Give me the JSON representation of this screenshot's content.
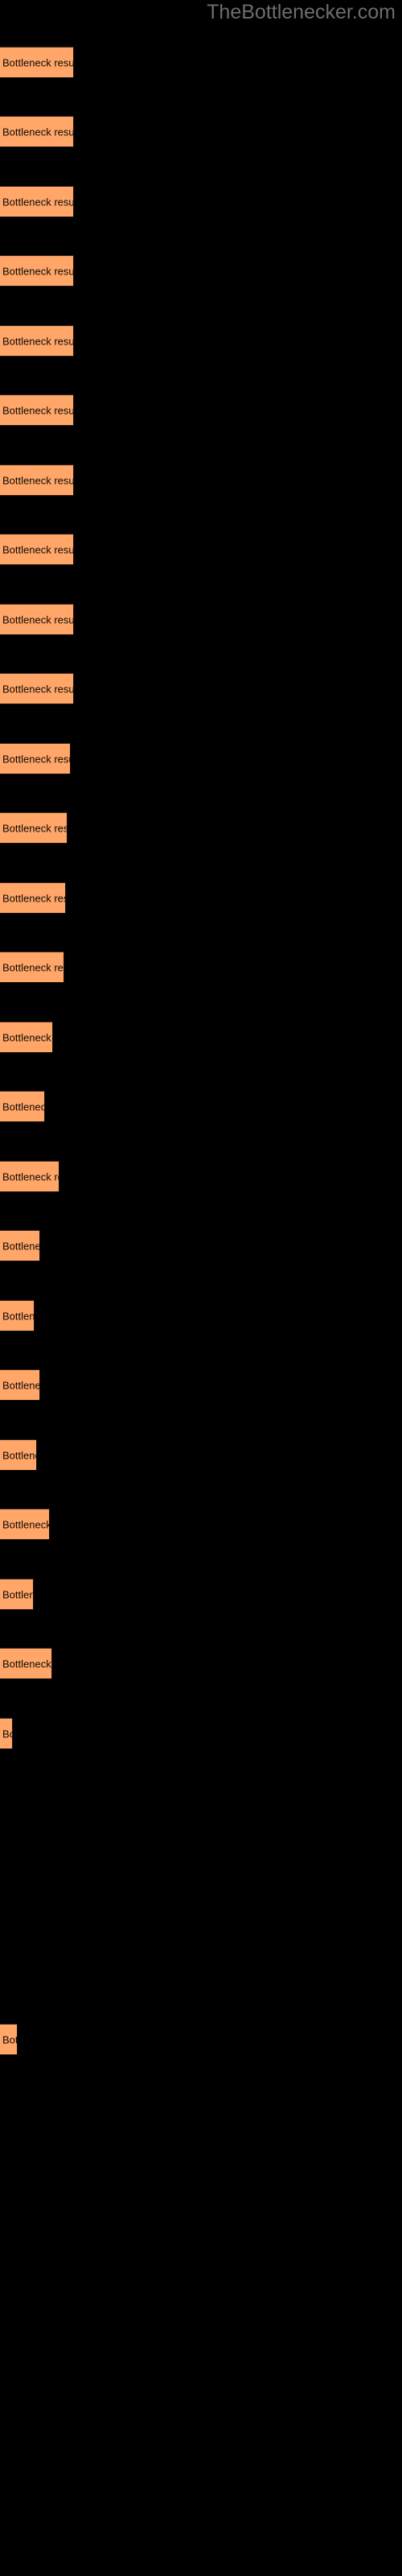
{
  "header": {
    "site_title": "TheBottlenecker.com"
  },
  "colors": {
    "background": "#000000",
    "bar_fill": "#ffa668",
    "bar_border": "#1a1008",
    "label_text": "#100c08",
    "title_text": "#6d6d6d"
  },
  "chart_data": {
    "type": "bar",
    "orientation": "horizontal",
    "title": "TheBottlenecker.com",
    "xlabel": "",
    "ylabel": "",
    "grid": false,
    "legend": false,
    "bar_label_text": "Bottleneck result",
    "categories": [
      "Bottleneck result",
      "Bottleneck result",
      "Bottleneck result",
      "Bottleneck result",
      "Bottleneck result",
      "Bottleneck result",
      "Bottleneck result",
      "Bottleneck result",
      "Bottleneck result",
      "Bottleneck result",
      "Bottleneck result",
      "Bottleneck result",
      "Bottleneck result",
      "Bottleneck result",
      "Bottleneck result",
      "Bottleneck result",
      "Bottleneck result",
      "Bottleneck result",
      "Bottleneck result",
      "Bottleneck result",
      "Bottleneck result",
      "Bottleneck result",
      "Bottleneck result",
      "Bottleneck result",
      "Bottleneck result"
    ],
    "values": [
      92,
      92,
      92,
      92,
      92,
      92,
      92,
      92,
      92,
      92,
      88,
      84,
      82,
      80,
      66,
      56,
      74,
      50,
      43,
      50,
      46,
      62,
      42,
      65,
      16
    ],
    "xlim": [
      0,
      500
    ],
    "bars": [
      {
        "index": 1,
        "y": 58,
        "width": 92,
        "visible_text": "Bottleneck result"
      },
      {
        "index": 2,
        "y": 144,
        "width": 92,
        "visible_text": "Bottleneck result"
      },
      {
        "index": 3,
        "y": 231,
        "width": 92,
        "visible_text": "Bottleneck result"
      },
      {
        "index": 4,
        "y": 317,
        "width": 92,
        "visible_text": "Bottleneck result"
      },
      {
        "index": 5,
        "y": 404,
        "width": 92,
        "visible_text": "Bottleneck result"
      },
      {
        "index": 6,
        "y": 490,
        "width": 92,
        "visible_text": "Bottleneck result"
      },
      {
        "index": 7,
        "y": 577,
        "width": 92,
        "visible_text": "Bottleneck result"
      },
      {
        "index": 8,
        "y": 663,
        "width": 92,
        "visible_text": "Bottleneck result"
      },
      {
        "index": 9,
        "y": 750,
        "width": 92,
        "visible_text": "Bottleneck result"
      },
      {
        "index": 10,
        "y": 836,
        "width": 92,
        "visible_text": "Bottleneck result"
      },
      {
        "index": 11,
        "y": 923,
        "width": 88,
        "visible_text": "Bottleneck result"
      },
      {
        "index": 12,
        "y": 1009,
        "width": 84,
        "visible_text": "Bottleneck result"
      },
      {
        "index": 13,
        "y": 1096,
        "width": 82,
        "visible_text": "Bottleneck result"
      },
      {
        "index": 14,
        "y": 1182,
        "width": 80,
        "visible_text": "Bottleneck result"
      },
      {
        "index": 15,
        "y": 1269,
        "width": 66,
        "visible_text": "Bottleneck resu"
      },
      {
        "index": 16,
        "y": 1355,
        "width": 56,
        "visible_text": "Bottleneck"
      },
      {
        "index": 17,
        "y": 1442,
        "width": 74,
        "visible_text": "Bottleneck res"
      },
      {
        "index": 18,
        "y": 1528,
        "width": 50,
        "visible_text": "Bottlenec"
      },
      {
        "index": 19,
        "y": 1615,
        "width": 43,
        "visible_text": "Bottler"
      },
      {
        "index": 20,
        "y": 1701,
        "width": 50,
        "visible_text": "Bottlenec"
      },
      {
        "index": 21,
        "y": 1788,
        "width": 46,
        "visible_text": "Bottlene"
      },
      {
        "index": 22,
        "y": 1874,
        "width": 62,
        "visible_text": "Bottleneck r"
      },
      {
        "index": 23,
        "y": 1961,
        "width": 42,
        "visible_text": "Bottle"
      },
      {
        "index": 24,
        "y": 2047,
        "width": 65,
        "visible_text": "Bottlened"
      },
      {
        "index": 25,
        "y": 2134,
        "width": 16,
        "visible_text": "B"
      },
      {
        "index": 26,
        "y": 2514,
        "width": 22,
        "visible_text": "Bo"
      }
    ]
  }
}
